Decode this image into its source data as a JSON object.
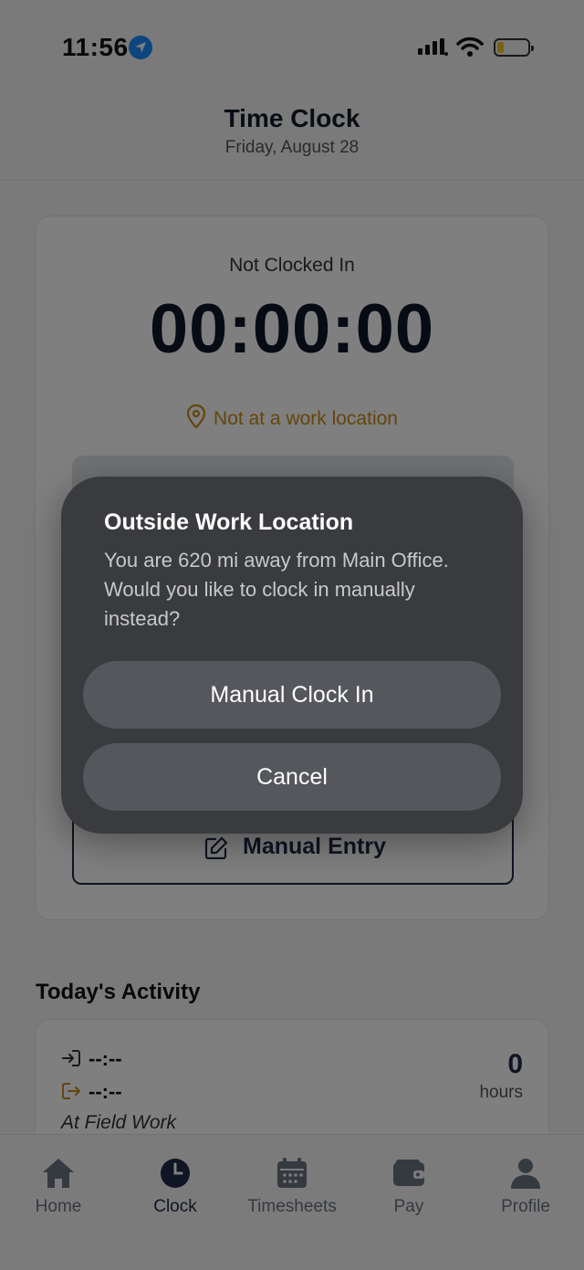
{
  "status_bar": {
    "time": "11:56"
  },
  "header": {
    "title": "Time Clock",
    "date": "Friday, August 28"
  },
  "clock": {
    "status": "Not Clocked In",
    "timer": "00:00:00",
    "location_status": "Not at a work location",
    "manual_entry_label": "Manual Entry"
  },
  "activity": {
    "title": "Today's Activity",
    "clock_in_time": "--:--",
    "clock_out_time": "--:--",
    "location": "At Field Work",
    "hours_value": "0",
    "hours_label": "hours"
  },
  "tabs": [
    {
      "label": "Home",
      "icon": "home-icon"
    },
    {
      "label": "Clock",
      "icon": "clock-icon",
      "active": true
    },
    {
      "label": "Timesheets",
      "icon": "calendar-icon"
    },
    {
      "label": "Pay",
      "icon": "wallet-icon"
    },
    {
      "label": "Profile",
      "icon": "person-icon"
    }
  ],
  "alert": {
    "title": "Outside Work Location",
    "message": "You are 620 mi away from Main Office. Would you like to clock in manually instead?",
    "primary_button": "Manual Clock In",
    "secondary_button": "Cancel"
  },
  "colors": {
    "warning": "#c98a1a",
    "navy": "#1f2a44",
    "location_blue": "#1a8cff"
  }
}
